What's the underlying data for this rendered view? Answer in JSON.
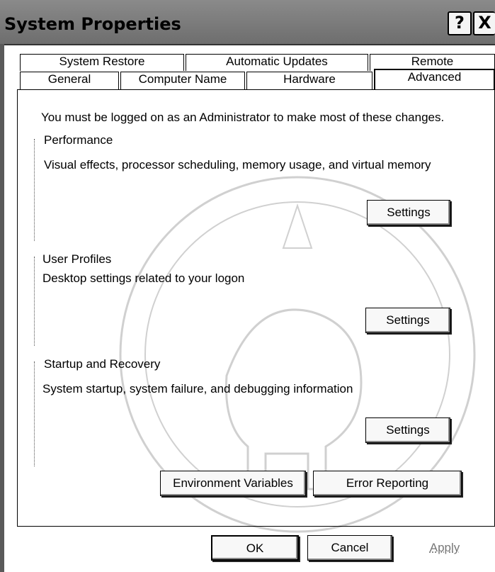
{
  "window": {
    "title": "System Properties",
    "help_label": "?",
    "close_label": "X"
  },
  "tabs": {
    "row1": [
      "System Restore",
      "Automatic Updates",
      "Remote"
    ],
    "row2": [
      "General",
      "Computer Name",
      "Hardware",
      "Advanced"
    ],
    "active": "Advanced"
  },
  "main": {
    "admin_notice": "You must be logged on as an Administrator to make most of these changes.",
    "performance": {
      "label": "Performance",
      "description": "Visual effects, processor scheduling, memory usage, and virtual memory",
      "button": "Settings"
    },
    "user_profiles": {
      "label": "User Profiles",
      "description": "Desktop settings related to your logon",
      "button": "Settings"
    },
    "startup_recovery": {
      "label": "Startup and Recovery",
      "description": "System startup, system failure, and debugging information",
      "button": "Settings"
    },
    "environment_button": "Environment Variables",
    "error_reporting_button": "Error Reporting"
  },
  "footer": {
    "ok": "OK",
    "cancel": "Cancel",
    "apply": "Apply"
  }
}
